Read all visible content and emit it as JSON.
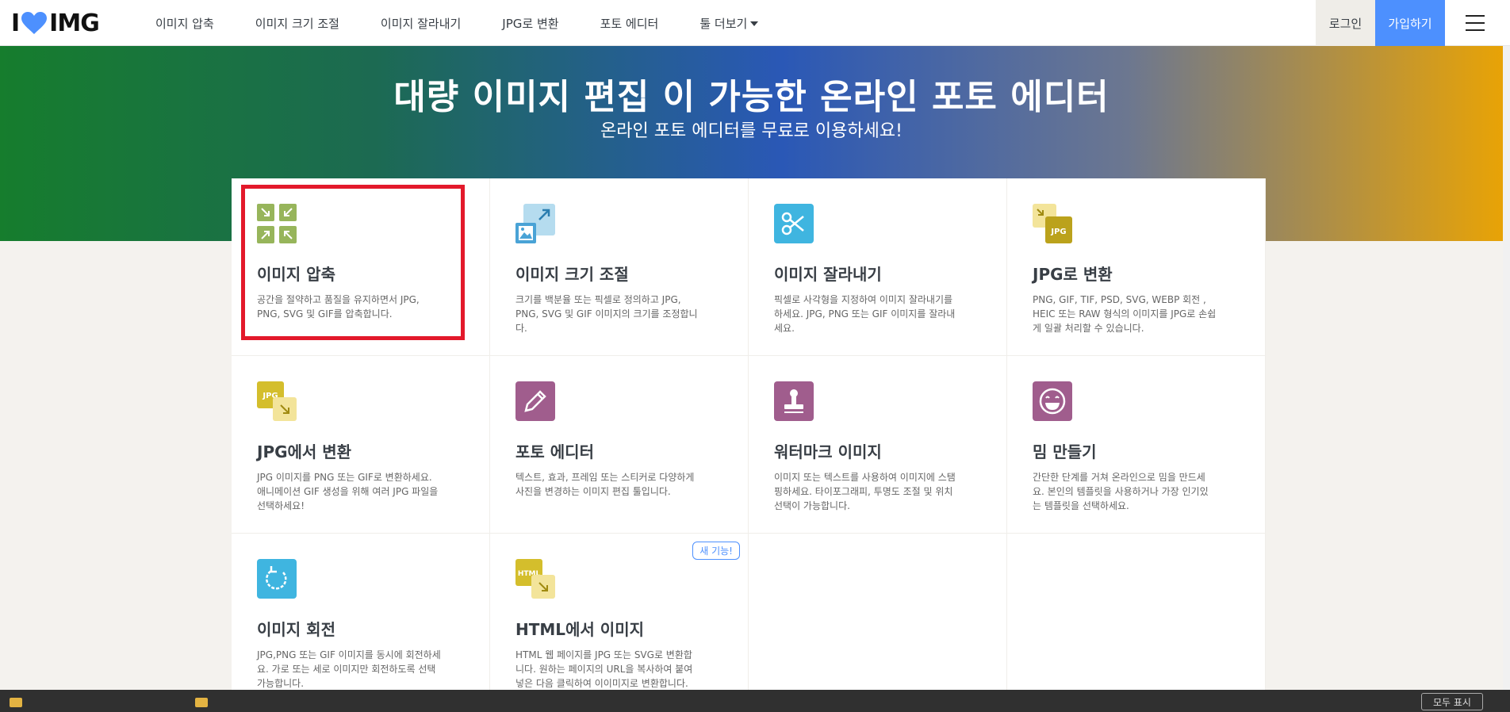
{
  "nav": {
    "logo_left": "I",
    "logo_right": "IMG",
    "menu": [
      {
        "label": "이미지 압축"
      },
      {
        "label": "이미지 크기 조절"
      },
      {
        "label": "이미지 잘라내기"
      },
      {
        "label": "JPG로 변환"
      },
      {
        "label": "포토 에디터"
      },
      {
        "label": "툴 더보기"
      }
    ],
    "login": "로그인",
    "signup": "가입하기"
  },
  "hero": {
    "title": "대량 이미지 편집 이 가능한 온라인 포토 에디터",
    "subtitle": "온라인 포토 에디터를 무료로 이용하세요!"
  },
  "tools": [
    {
      "title": "이미지 압축",
      "desc": "공간을 절약하고 품질을 유지하면서 JPG, PNG, SVG 및 GIF를 압축합니다.",
      "icon": "compress-icon",
      "color": "#97b55b"
    },
    {
      "title": "이미지 크기 조절",
      "desc": "크기를 백분율 또는 픽셀로 정의하고 JPG, PNG, SVG 및 GIF 이미지의 크기를 조정합니다.",
      "icon": "resize-icon",
      "color": "#6fb8e0"
    },
    {
      "title": "이미지 잘라내기",
      "desc": "픽셀로 사각형을 지정하여 이미지 잘라내기를 하세요. JPG, PNG 또는 GIF 이미지를 잘라내세요.",
      "icon": "scissors-icon",
      "color": "#3fb5e0"
    },
    {
      "title": "JPG로 변환",
      "desc": "PNG, GIF, TIF, PSD, SVG, WEBP 회전 , HEIC 또는 RAW 형식의 이미지를 JPG로 손쉽게 일괄 처리할 수 있습니다.",
      "icon": "to-jpg-icon",
      "color": "#c9b32b"
    },
    {
      "title": "JPG에서 변환",
      "desc": "JPG 이미지를 PNG 또는 GIF로 변환하세요. 애니메이션 GIF 생성을 위해 여러 JPG 파일을 선택하세요!",
      "icon": "from-jpg-icon",
      "color": "#d4be2c"
    },
    {
      "title": "포토 에디터",
      "desc": "텍스트, 효과, 프레임 또는 스티커로 다양하게 사진을 변경하는 이미지 편집 툴입니다.",
      "icon": "pencil-icon",
      "color": "#a05d8d"
    },
    {
      "title": "워터마크 이미지",
      "desc": "이미지 또는 텍스트를 사용하여 이미지에 스탬핑하세요. 타이포그래피, 투명도 조절 및 위치 선택이 가능합니다.",
      "icon": "stamp-icon",
      "color": "#a05d8d"
    },
    {
      "title": "밈 만들기",
      "desc": "간단한 단계를 거쳐 온라인으로 밈을 만드세요. 본인의 템플릿을 사용하거나 가장 인기있는 템플릿을 선택하세요.",
      "icon": "laugh-icon",
      "color": "#a05d8d"
    },
    {
      "title": "이미지 회전",
      "desc": "JPG,PNG 또는 GIF 이미지를 동시에 회전하세요. 가로 또는 세로 이미지만 회전하도록 선택 가능합니다.",
      "icon": "rotate-icon",
      "color": "#3fb5e0"
    },
    {
      "title": "HTML에서 이미지",
      "desc": "HTML 웹 페이지를 JPG 또는 SVG로 변환합니다. 원하는 페이지의 URL을 복사하여 붙여넣은 다음 클릭하여 이이미지로 변환합니다.",
      "icon": "html-icon",
      "color": "#d4be2c",
      "badge": "새 기능!"
    }
  ],
  "taskbar": {
    "button": "모두 표시"
  }
}
